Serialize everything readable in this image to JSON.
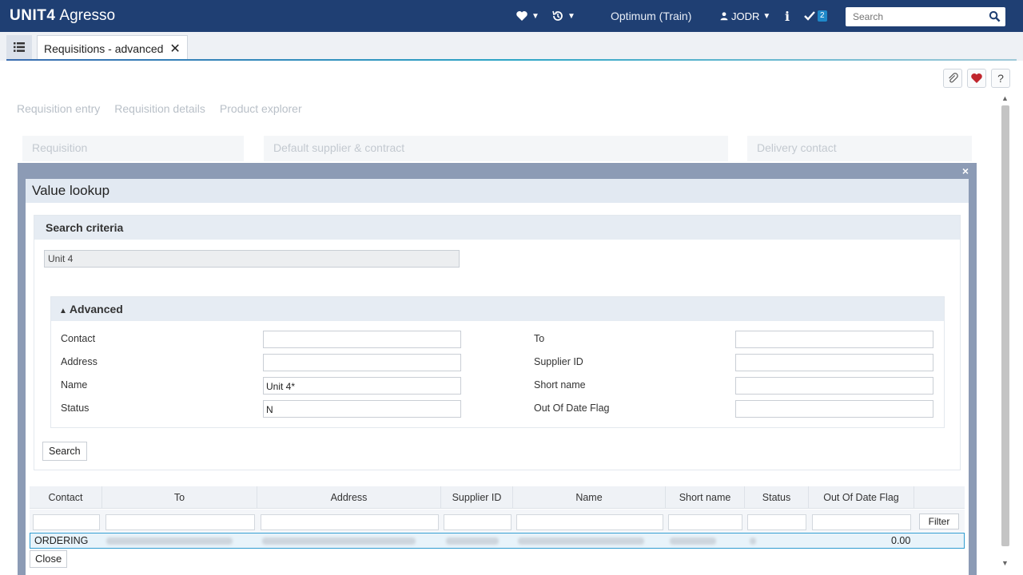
{
  "header": {
    "brand": "UNIT4",
    "product": "Agresso",
    "environment": "Optimum (Train)",
    "user": "JODR",
    "tasks_count": "2",
    "search_placeholder": "Search"
  },
  "tabs": [
    {
      "label": "Requisitions - advanced"
    }
  ],
  "page": {
    "subtabs": [
      "Requisition entry",
      "Requisition details",
      "Product explorer"
    ],
    "panels": [
      "Requisition",
      "Default supplier & contract",
      "Delivery contact"
    ]
  },
  "modal": {
    "title": "Value lookup",
    "close_glyph": "×",
    "criteria": {
      "heading": "Search criteria",
      "main_value": "Unit 4"
    },
    "advanced": {
      "heading": "Advanced",
      "left_fields": [
        {
          "label": "Contact",
          "value": ""
        },
        {
          "label": "Address",
          "value": ""
        },
        {
          "label": "Name",
          "value": "Unit 4*"
        },
        {
          "label": "Status",
          "value": "N"
        }
      ],
      "right_fields": [
        {
          "label": "To",
          "value": ""
        },
        {
          "label": "Supplier ID",
          "value": ""
        },
        {
          "label": "Short name",
          "value": ""
        },
        {
          "label": "Out Of Date Flag",
          "value": ""
        }
      ]
    },
    "search_label": "Search",
    "grid": {
      "columns": [
        "Contact",
        "To",
        "Address",
        "Supplier ID",
        "Name",
        "Short name",
        "Status",
        "Out Of Date Flag"
      ],
      "filter_label": "Filter",
      "rows": [
        {
          "contact": "ORDERING",
          "amount": "0.00"
        }
      ]
    },
    "close_label": "Close"
  },
  "colors": {
    "topbar": "#1f3f73",
    "modal_frame": "#8c9bb5",
    "row_selected_border": "#2f9bd0"
  }
}
